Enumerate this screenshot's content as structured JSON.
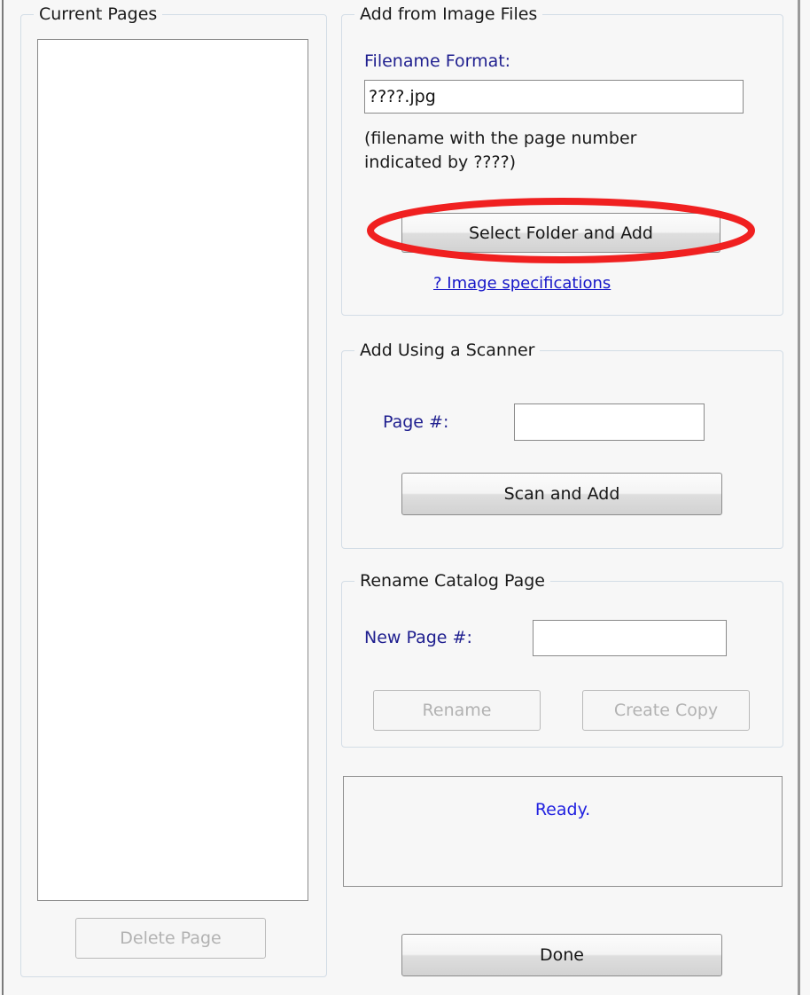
{
  "left_panel": {
    "group_title": "Current Pages",
    "list_items": [],
    "delete_button": {
      "label": "Delete Page",
      "enabled": false
    }
  },
  "image_files_group": {
    "group_title": "Add from Image Files",
    "filename_format_label": "Filename Format:",
    "filename_format_value": "????.jpg",
    "filename_format_placeholder": "",
    "hint_line_1": "(filename with the page number",
    "hint_line_2": "indicated by  ????)",
    "select_folder_button": {
      "label": "Select Folder and Add",
      "enabled": true
    },
    "specifications_link": "? Image specifications"
  },
  "scanner_group": {
    "group_title": "Add Using a Scanner",
    "page_number_label": "Page #:",
    "page_number_value": "",
    "page_number_placeholder": "",
    "scan_button": {
      "label": "Scan and Add",
      "enabled": true
    }
  },
  "rename_group": {
    "group_title": "Rename Catalog Page",
    "new_page_number_label": "New Page #:",
    "new_page_number_value": "",
    "new_page_number_placeholder": "",
    "rename_button": {
      "label": "Rename",
      "enabled": false
    },
    "create_copy_button": {
      "label": "Create Copy",
      "enabled": false
    }
  },
  "status": {
    "message": "Ready."
  },
  "footer": {
    "done_button": {
      "label": "Done",
      "enabled": true
    }
  },
  "annotation": {
    "shape": "ellipse",
    "color": "#f02020",
    "targets": "select-folder-and-add-button"
  },
  "colors": {
    "window_background": "#f7f7f7",
    "group_border": "#d3dde6",
    "label_blue": "#1f1f8f",
    "link_blue": "#1616c8",
    "status_blue": "#2222e0",
    "annotation_red": "#f02020",
    "control_border": "#8a8a8a",
    "disabled_text": "#b2b2b2"
  }
}
